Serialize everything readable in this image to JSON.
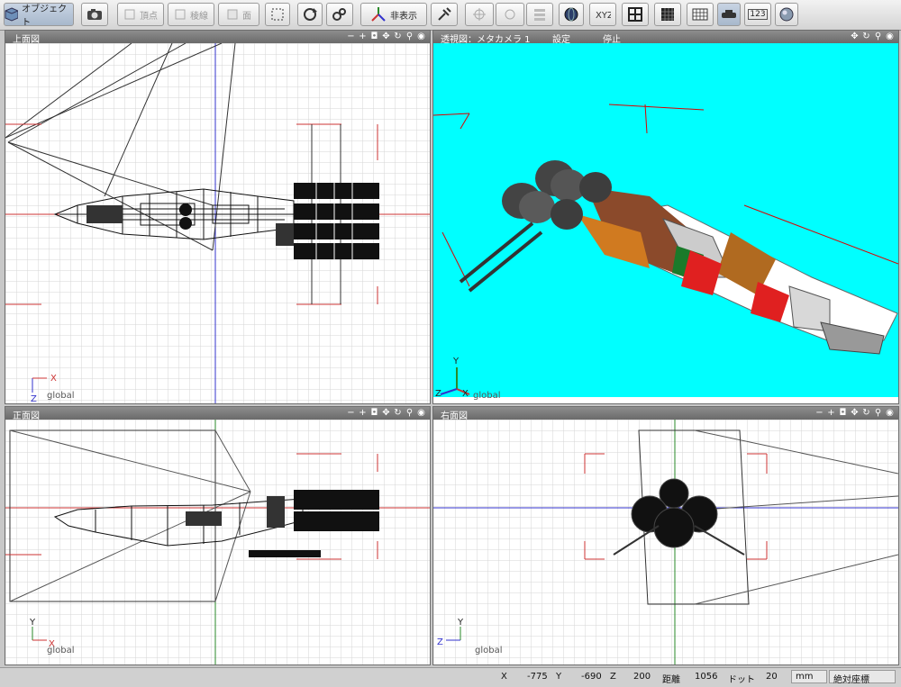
{
  "toolbar": {
    "object_label": "オブジェクト",
    "vertex_label": "頂点",
    "edge_label": "稜線",
    "face_label": "面",
    "hide_label": "非表示",
    "num_label": "123"
  },
  "viewports": {
    "top": {
      "title": "上面図",
      "axis_x": "X",
      "axis_z": "Z",
      "global": "global"
    },
    "persp": {
      "title": "透視図：メタカメラ 1",
      "setting": "設定",
      "stop": "停止",
      "axis_y": "Y",
      "axis_x": "X",
      "axis_z": "Z",
      "global": "global",
      "bg_color": "#00ffff"
    },
    "front": {
      "title": "正面図",
      "axis_y": "Y",
      "axis_x": "X",
      "global": "global"
    },
    "right": {
      "title": "右面図",
      "axis_y": "Y",
      "axis_z": "Z",
      "global": "global"
    }
  },
  "status": {
    "x_label": "X",
    "x_value": "-775",
    "y_label": "Y",
    "y_value": "-690",
    "z_label": "Z",
    "z_value": "200",
    "dist_label": "距離",
    "dist_value": "1056",
    "dot_label": "ドット",
    "dot_value": "20",
    "unit": "mm",
    "coord_mode": "絶対座標"
  }
}
